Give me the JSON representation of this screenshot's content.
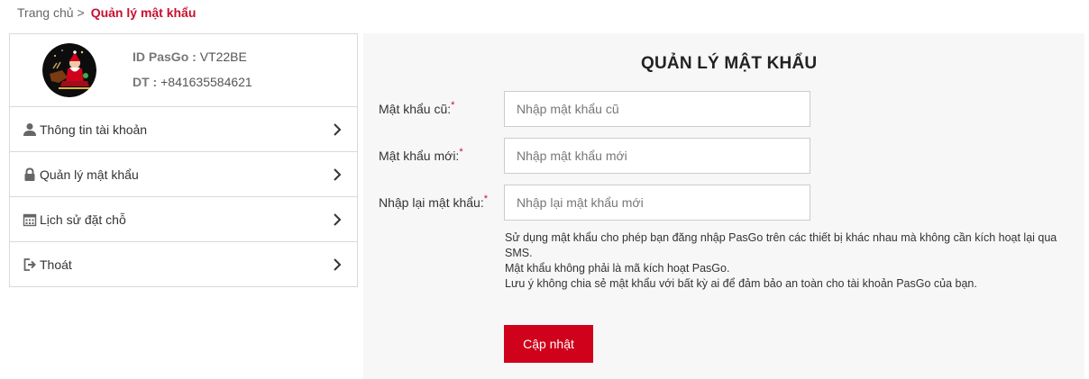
{
  "breadcrumb": {
    "home": "Trang chủ",
    "separator": ">",
    "current": "Quản lý mật khẩu"
  },
  "profile": {
    "id_label": "ID PasGo :",
    "id_value": "VT22BE",
    "phone_label": "DT :",
    "phone_value": "+841635584621"
  },
  "sidebar": {
    "items": [
      {
        "label": "Thông tin tài khoản",
        "icon": "user-icon"
      },
      {
        "label": "Quản lý mật khẩu",
        "icon": "lock-icon"
      },
      {
        "label": "Lịch sử đặt chỗ",
        "icon": "calendar-icon"
      },
      {
        "label": "Thoát",
        "icon": "logout-icon"
      }
    ]
  },
  "form": {
    "title": "QUẢN LÝ MẬT KHẨU",
    "required_mark": "*",
    "old_password": {
      "label": "Mật khẩu cũ:",
      "placeholder": "Nhập mật khẩu cũ",
      "value": ""
    },
    "new_password": {
      "label": "Mật khẩu mới:",
      "placeholder": "Nhập mật khẩu mới",
      "value": ""
    },
    "confirm_password": {
      "label": "Nhập lại mật khẩu:",
      "placeholder": "Nhập lại mật khẩu mới",
      "value": ""
    },
    "hints": [
      "Sử dụng mật khẩu cho phép bạn đăng nhập PasGo trên các thiết bị khác nhau mà không cần kích hoạt lại qua SMS.",
      "Mật khẩu không phải là mã kích hoạt PasGo.",
      "Lưu ý không chia sẻ mật khẩu với bất kỳ ai để đảm bảo an toàn cho tài khoản PasGo của bạn."
    ],
    "submit_label": "Cập nhật"
  },
  "colors": {
    "accent": "#d0021b",
    "breadcrumb_current": "#c8102e",
    "panel_bg": "#f7f7f7",
    "border": "#d9d9d9"
  }
}
